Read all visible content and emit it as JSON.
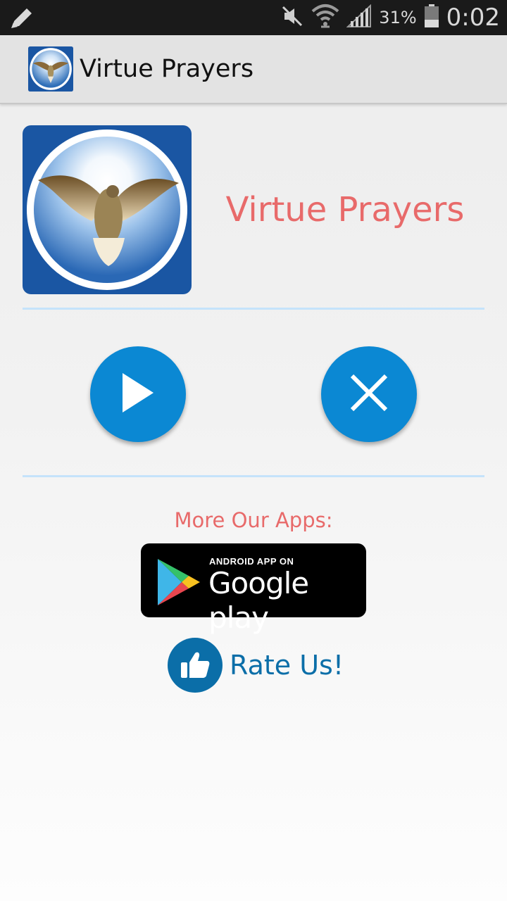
{
  "status_bar": {
    "battery_percent": "31%",
    "time": "0:02",
    "icons": [
      "edit-icon",
      "mute-icon",
      "wifi-icon",
      "signal-icon",
      "battery-icon"
    ]
  },
  "action_bar": {
    "title": "Virtue Prayers",
    "icon": "dove-app-icon"
  },
  "header": {
    "app_name": "Virtue Prayers",
    "icon": "dove-app-icon"
  },
  "controls": {
    "play_icon": "play-icon",
    "close_icon": "close-icon"
  },
  "more_apps": {
    "label": "More Our Apps:",
    "badge_small": "ANDROID APP ON",
    "badge_big": "Google play"
  },
  "rate": {
    "label": "Rate Us!",
    "icon": "thumbs-up-icon"
  },
  "colors": {
    "accent_red": "#e86a6a",
    "fab_blue": "#0b88d3",
    "rate_blue": "#0b6ea8",
    "divider_blue": "#c5e3fb"
  }
}
